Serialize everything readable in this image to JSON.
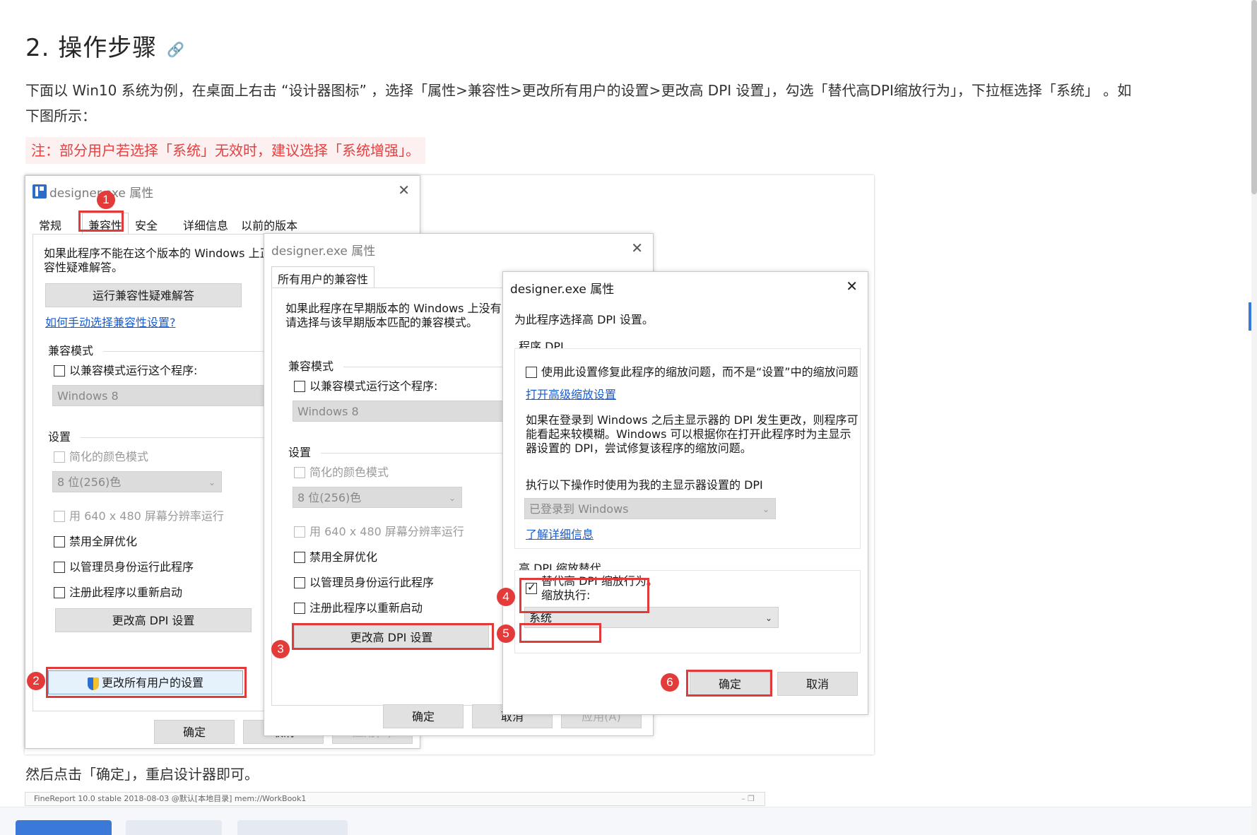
{
  "heading": {
    "text": "2. 操作步骤",
    "icon": "link-icon"
  },
  "para1": "下面以 Win10 系统为例，在桌面上右击 “设计器图标” ，选择「属性>兼容性>更改所有用户的设置>更改高 DPI 设置」，勾选「替代高DPI缩放行为」，下拉框选择「系统」 。如下图所示：",
  "note": "注：部分用户若选择「系统」无效时，建议选择「系统增强」。",
  "dialog1": {
    "title": "designer.exe 属性",
    "tabs": [
      "常规",
      "兼容性",
      "安全",
      "详细信息",
      "以前的版本"
    ],
    "intro": "如果此程序不能在这个版本的 Windows 上正",
    "intro2": "容性疑难解答。",
    "run_troubleshooter": "运行兼容性疑难解答",
    "manual_link": "如何手动选择兼容性设置?",
    "compat_mode_group": "兼容模式",
    "compat_mode_check": "以兼容模式运行这个程序:",
    "compat_mode_value": "Windows 8",
    "settings_group": "设置",
    "reduced_color": "简化的颜色模式",
    "color_value": "8 位(256)色",
    "run_640": "用 640 x 480 屏幕分辨率运行",
    "disable_fullscreen": "禁用全屏优化",
    "run_admin": "以管理员身份运行此程序",
    "register_restart": "注册此程序以重新启动",
    "change_dpi": "更改高 DPI 设置",
    "change_all_users": "更改所有用户的设置",
    "ok": "确定",
    "cancel": "取消",
    "apply": "应用(A)"
  },
  "dialog2": {
    "title": "designer.exe 属性",
    "tab": "所有用户的兼容性",
    "intro": "如果此程序在早期版本的 Windows 上没有问",
    "intro2": "请选择与该早期版本匹配的兼容模式。",
    "compat_mode_group": "兼容模式",
    "compat_mode_check": "以兼容模式运行这个程序:",
    "compat_mode_value": "Windows 8",
    "settings_group": "设置",
    "reduced_color": "简化的颜色模式",
    "color_value": "8 位(256)色",
    "run_640": "用 640 x 480 屏幕分辨率运行",
    "disable_fullscreen": "禁用全屏优化",
    "run_admin": "以管理员身份运行此程序",
    "register_restart": "注册此程序以重新启动",
    "change_dpi": "更改高 DPI 设置",
    "ok": "确定",
    "cancel": "取消",
    "apply": "应用(A)"
  },
  "dialog3": {
    "title": "designer.exe 属性",
    "heading": "为此程序选择高 DPI 设置。",
    "program_dpi_group": "程序 DPI",
    "use_setting_check": "使用此设置修复此程序的缩放问题，而不是“设置”中的缩放问题",
    "advanced_link": "打开高级缩放设置",
    "explain1": "如果在登录到 Windows 之后主显示器的 DPI 发生更改，则程序可",
    "explain2": "能看起来较模糊。Windows 可以根据你在打开此程序时为主显示",
    "explain3": "器设置的 DPI，尝试修复该程序的缩放问题。",
    "use_dpi_label": "执行以下操作时使用为我的主显示器设置的 DPI",
    "use_dpi_value": "已登录到 Windows",
    "learn_more": "了解详细信息",
    "override_group": "高 DPI 缩放替代",
    "override_check": "替代高 DPI 缩放行为。",
    "override_check2": "缩放执行:",
    "scaling_value": "系统",
    "ok": "确定",
    "cancel": "取消"
  },
  "badges": [
    "1",
    "2",
    "3",
    "4",
    "5",
    "6"
  ],
  "para2": "然后点击「确定」，重启设计器即可。",
  "strip": {
    "title": "FineReport 10.0 stable 2018-08-03 @默认[本地目录]    mem://WorkBook1",
    "controls": "–    ❐"
  },
  "colors": {
    "accent_red": "#e03a3a",
    "link_blue": "#1a5ccf",
    "note_red": "#e34141"
  }
}
